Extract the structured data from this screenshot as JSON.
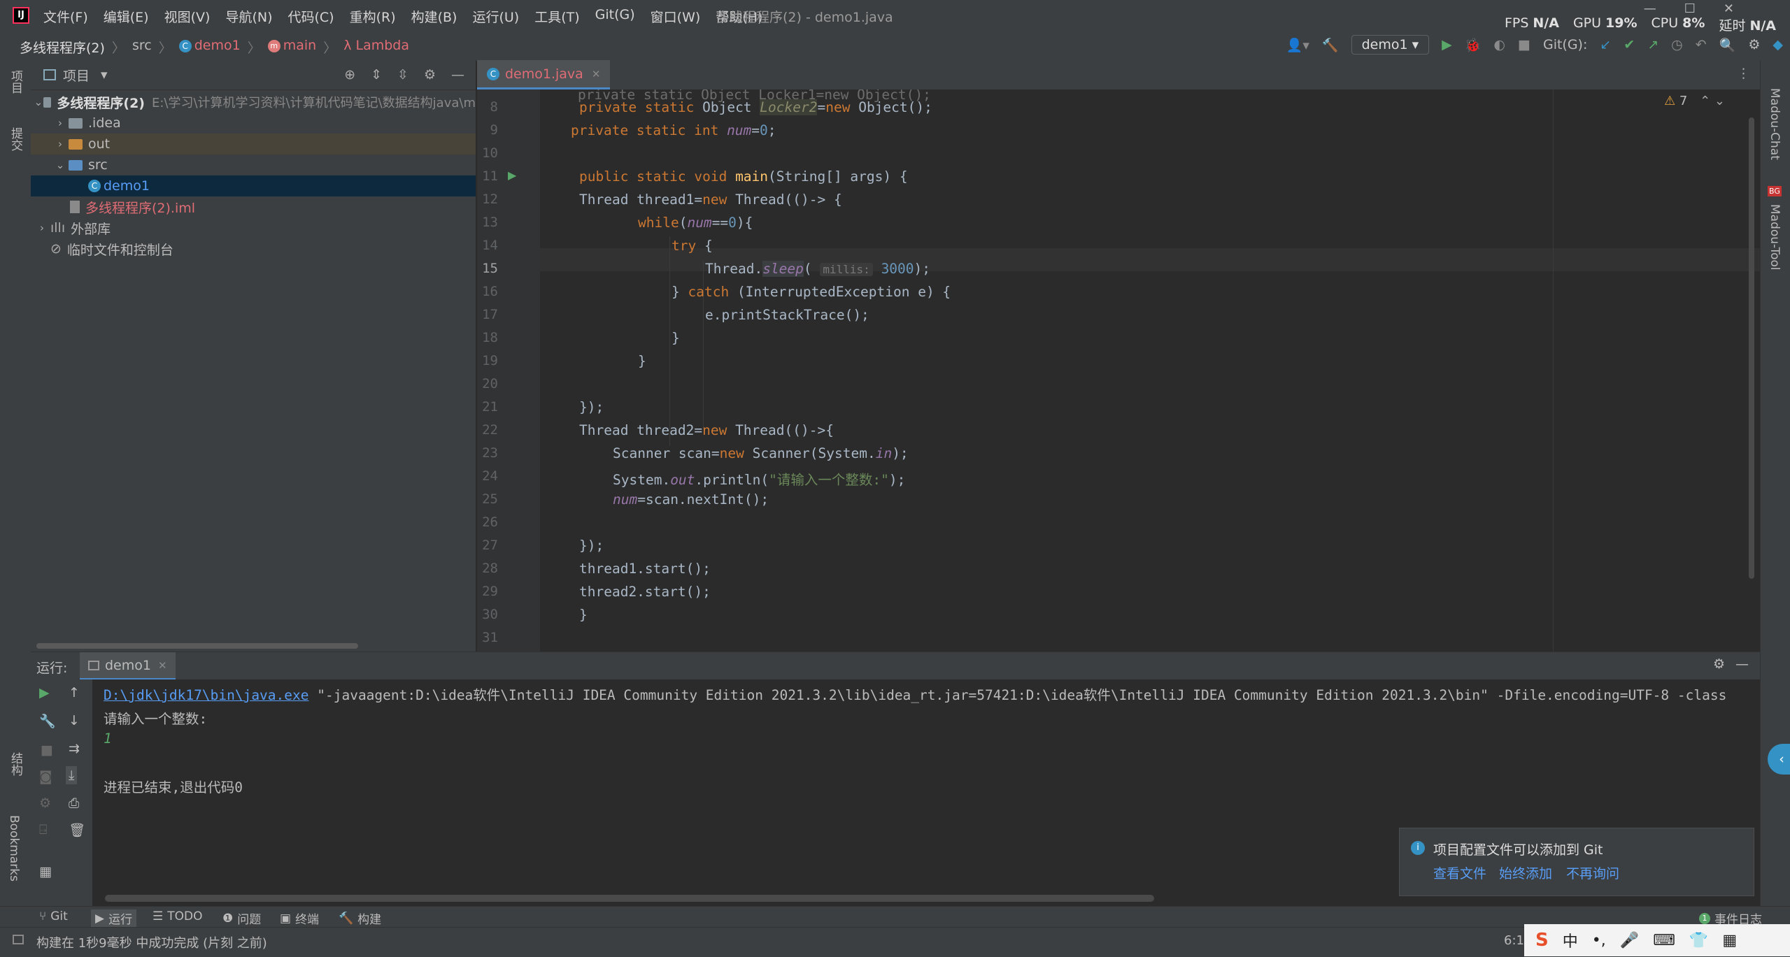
{
  "app": {
    "menus": [
      "文件(F)",
      "编辑(E)",
      "视图(V)",
      "导航(N)",
      "代码(C)",
      "重构(R)",
      "构建(B)",
      "运行(U)",
      "工具(T)",
      "Git(G)",
      "窗口(W)",
      "帮助(H)"
    ],
    "window_title": "多线程程序(2) - demo1.java",
    "metrics": {
      "fps_label": "FPS",
      "fps_value": "N/A",
      "gpu_label": "GPU",
      "gpu_value": "19%",
      "cpu_label": "CPU",
      "cpu_value": "8%",
      "latency_label": "延时",
      "latency_value": "N/A"
    }
  },
  "breadcrumb": {
    "project": "多线程程序(2)",
    "src": "src",
    "class": "demo1",
    "method": "main",
    "lambda": "Lambda"
  },
  "toolbar": {
    "run_config": "demo1",
    "git_label": "Git(G):"
  },
  "project_panel": {
    "title": "项目",
    "tree": [
      {
        "label": "多线程程序(2)",
        "path": "E:\\学习\\计算机学习资料\\计算机代码笔记\\数据结构java\\m"
      },
      {
        "label": ".idea"
      },
      {
        "label": "out"
      },
      {
        "label": "src"
      },
      {
        "label": "demo1"
      },
      {
        "label": "多线程程序(2).iml"
      },
      {
        "label": "外部库"
      },
      {
        "label": "临时文件和控制台"
      }
    ]
  },
  "left_strip": {
    "project": "项目",
    "commit": "提交",
    "structure": "结构",
    "bookmarks": "Bookmarks"
  },
  "right_strip": {
    "chat": "Madou-Chat",
    "tool": "Madou-Tool"
  },
  "editor": {
    "tab": "demo1.java",
    "warnings": "7",
    "line_numbers": [
      "8",
      "9",
      "10",
      "11",
      "12",
      "13",
      "14",
      "15",
      "16",
      "17",
      "18",
      "19",
      "20",
      "21",
      "22",
      "23",
      "24",
      "25",
      "26",
      "27",
      "28",
      "29",
      "30",
      "31"
    ],
    "code_strings": {
      "prompt": "\"请输入一个整数:\""
    },
    "param_hint": "millis:",
    "sleep_value": "3000",
    "num_init": "0"
  },
  "run_panel": {
    "label": "运行:",
    "tab": "demo1",
    "java_path": "D:\\jdk\\jdk17\\bin\\java.exe",
    "command_args": " \"-javaagent:D:\\idea软件\\IntelliJ IDEA Community Edition 2021.3.2\\lib\\idea_rt.jar=57421:D:\\idea软件\\IntelliJ IDEA Community Edition 2021.3.2\\bin\" -Dfile.encoding=UTF-8 -class",
    "output_prompt": "请输入一个整数:",
    "input_value": "1",
    "exit_message": "进程已结束,退出代码0"
  },
  "notification": {
    "message": "项目配置文件可以添加到 Git",
    "actions": [
      "查看文件",
      "始终添加",
      "不再询问"
    ]
  },
  "bottom_tabs": [
    "Git",
    "运行",
    "TODO",
    "问题",
    "终端",
    "构建"
  ],
  "event_log": "事件日志",
  "status": {
    "message": "构建在 1秒9毫秒 中成功完成 (片刻 之前)",
    "position": "6:1"
  },
  "ime": {
    "lang": "中"
  }
}
